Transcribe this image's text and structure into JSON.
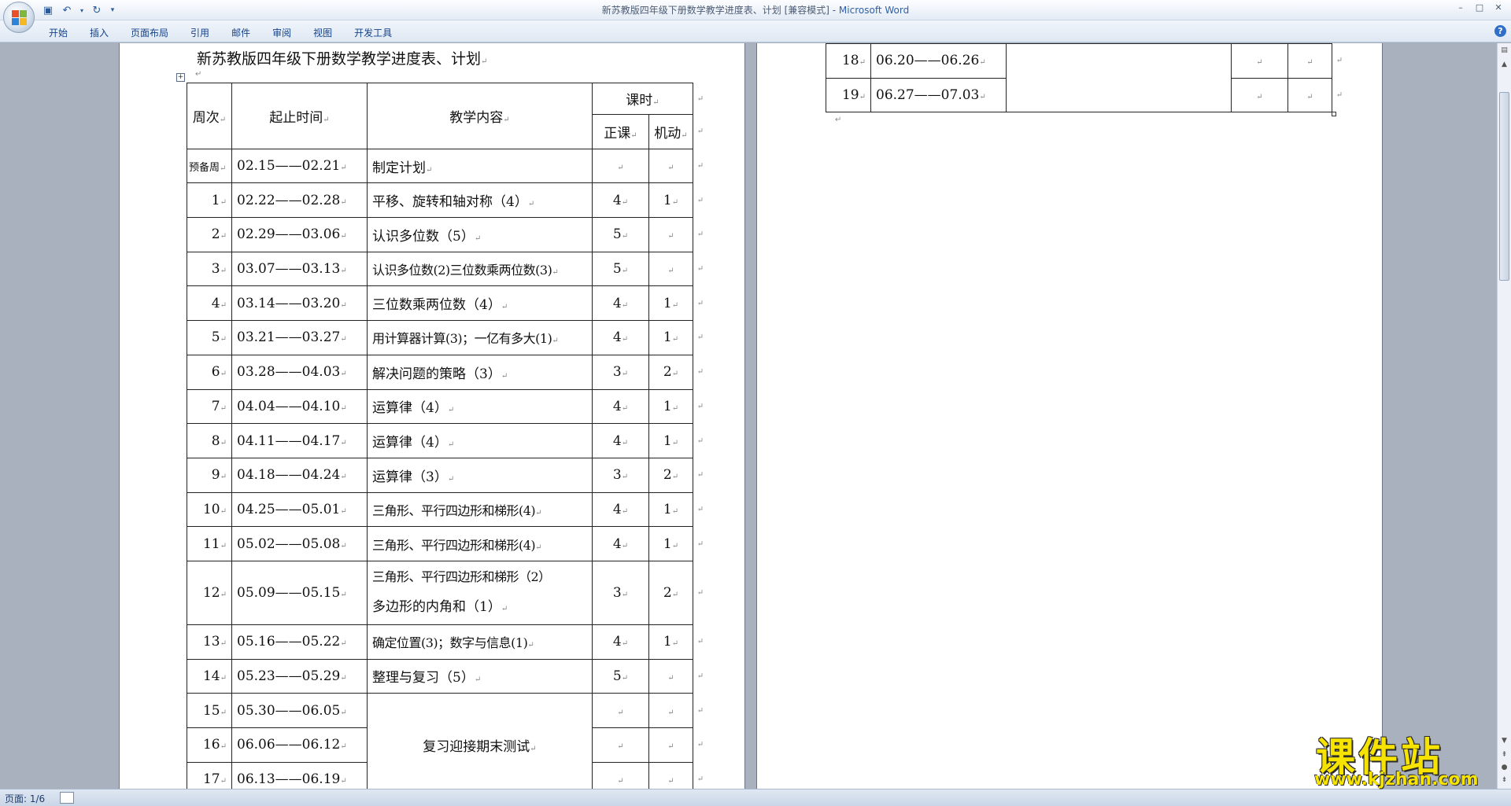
{
  "window": {
    "title": "新苏教版四年级下册数学教学进度表、计划 [兼容模式] - ",
    "app_name": "Microsoft Word",
    "controls": [
      "–",
      "□",
      "✕"
    ]
  },
  "ribbon": {
    "tabs": [
      "开始",
      "插入",
      "页面布局",
      "引用",
      "邮件",
      "审阅",
      "视图",
      "开发工具"
    ],
    "help": "?"
  },
  "document": {
    "title": "新苏教版四年级下册数学教学进度表、计划",
    "headers": {
      "week": "周次",
      "dates": "起止时间",
      "content": "教学内容",
      "hours": "课时",
      "regular": "正课",
      "flexible": "机动"
    },
    "rows": [
      {
        "week": "预备周",
        "dates": "02.15——02.21",
        "content": "制定计划",
        "regular": "",
        "flexible": ""
      },
      {
        "week": "1",
        "dates": "02.22——02.28",
        "content": "平移、旋转和轴对称（4）",
        "regular": "4",
        "flexible": "1"
      },
      {
        "week": "2",
        "dates": "02.29——03.06",
        "content": "认识多位数（5）",
        "regular": "5",
        "flexible": ""
      },
      {
        "week": "3",
        "dates": "03.07——03.13",
        "content": "认识多位数(2)三位数乘两位数(3)",
        "regular": "5",
        "flexible": ""
      },
      {
        "week": "4",
        "dates": "03.14——03.20",
        "content": "三位数乘两位数（4）",
        "regular": "4",
        "flexible": "1"
      },
      {
        "week": "5",
        "dates": "03.21——03.27",
        "content": "用计算器计算(3)；一亿有多大(1)",
        "regular": "4",
        "flexible": "1"
      },
      {
        "week": "6",
        "dates": "03.28——04.03",
        "content": "解决问题的策略（3）",
        "regular": "3",
        "flexible": "2"
      },
      {
        "week": "7",
        "dates": "04.04——04.10",
        "content": "运算律（4）",
        "regular": "4",
        "flexible": "1"
      },
      {
        "week": "8",
        "dates": "04.11——04.17",
        "content": "运算律（4）",
        "regular": "4",
        "flexible": "1"
      },
      {
        "week": "9",
        "dates": "04.18——04.24",
        "content": "运算律（3）",
        "regular": "3",
        "flexible": "2"
      },
      {
        "week": "10",
        "dates": "04.25——05.01",
        "content": "三角形、平行四边形和梯形(4)",
        "regular": "4",
        "flexible": "1"
      },
      {
        "week": "11",
        "dates": "05.02——05.08",
        "content": "三角形、平行四边形和梯形(4)",
        "regular": "4",
        "flexible": "1"
      },
      {
        "week": "12",
        "dates": "05.09——05.15",
        "content": "三角形、平行四边形和梯形（2）",
        "content2": "多边形的内角和（1）",
        "regular": "3",
        "flexible": "2"
      },
      {
        "week": "13",
        "dates": "05.16——05.22",
        "content": "确定位置(3)；数字与信息(1)",
        "regular": "4",
        "flexible": "1"
      },
      {
        "week": "14",
        "dates": "05.23——05.29",
        "content": "整理与复习（5）",
        "regular": "5",
        "flexible": ""
      },
      {
        "week": "15",
        "dates": "05.30——06.05",
        "content": "复习迎接期末测试",
        "regular": "",
        "flexible": ""
      },
      {
        "week": "16",
        "dates": "06.06——06.12",
        "regular": "",
        "flexible": ""
      },
      {
        "week": "17",
        "dates": "06.13——06.19",
        "regular": "",
        "flexible": ""
      }
    ],
    "rows_page2": [
      {
        "week": "18",
        "dates": "06.20——06.26",
        "regular": "",
        "flexible": ""
      },
      {
        "week": "19",
        "dates": "06.27——07.03",
        "regular": "",
        "flexible": ""
      }
    ]
  },
  "status": {
    "page_info": "页面: 1/6"
  },
  "watermark": {
    "name": "课件站",
    "url": "www.kjzhan.com"
  }
}
